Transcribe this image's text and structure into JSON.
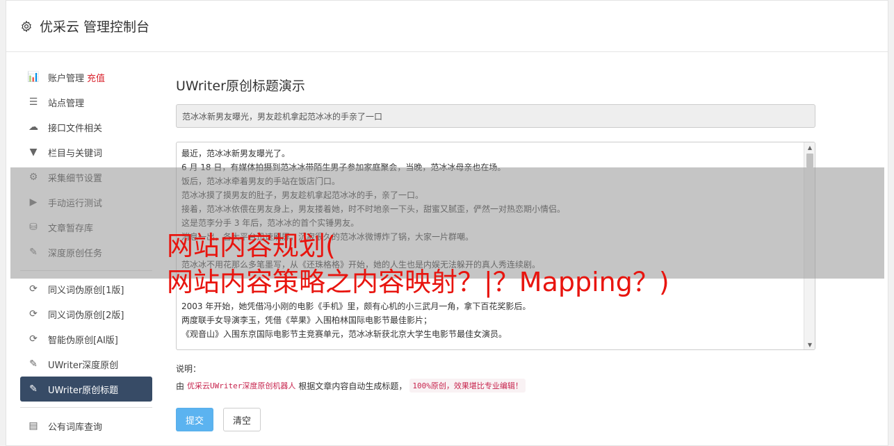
{
  "header": {
    "title": "优采云 管理控制台"
  },
  "sidebar": {
    "group1": [
      {
        "label": "账户管理",
        "badge": "充值",
        "icon": "bar-chart-icon",
        "glyph": "📊"
      },
      {
        "label": "站点管理",
        "icon": "server-icon",
        "glyph": "☰"
      },
      {
        "label": "接口文件相关",
        "icon": "cloud-upload-icon",
        "glyph": "☁"
      },
      {
        "label": "栏目与关键词",
        "icon": "filter-icon",
        "glyph": "▼"
      },
      {
        "label": "采集细节设置",
        "icon": "gears-icon",
        "glyph": "⚙"
      },
      {
        "label": "手动运行测试",
        "icon": "play-circle-icon",
        "glyph": "▶"
      },
      {
        "label": "文章暂存库",
        "icon": "database-icon",
        "glyph": "⛁"
      },
      {
        "label": "深度原创任务",
        "icon": "edit-icon",
        "glyph": "✎"
      }
    ],
    "group2": [
      {
        "label": "同义词伪原创[1版]",
        "icon": "refresh-icon",
        "glyph": "⟳"
      },
      {
        "label": "同义词伪原创[2版]",
        "icon": "refresh-icon",
        "glyph": "⟳"
      },
      {
        "label": "智能伪原创[AI版]",
        "icon": "refresh-icon",
        "glyph": "⟳"
      },
      {
        "label": "UWriter深度原创",
        "icon": "edit-icon",
        "glyph": "✎"
      },
      {
        "label": "UWriter原创标题",
        "icon": "edit-icon",
        "glyph": "✎",
        "active": true
      }
    ],
    "group3": [
      {
        "label": "公有词库查询",
        "icon": "book-icon",
        "glyph": "▤"
      }
    ]
  },
  "main": {
    "page_title": "UWriter原创标题演示",
    "title_value": "范冰冰新男友曝光，男友趁机拿起范冰冰的手亲了一口",
    "content_lines": [
      "最近，范冰冰新男友曝光了。",
      "6 月 18 日，有媒体拍摄到范冰冰带陌生男子参加家庭聚会，当晚，范冰冰母亲也在场。",
      "饭后，范冰冰牵着男友的手站在饭店门口。",
      "范冰冰摸了摸男友的肚子，男友趁机拿起范冰冰的手，亲了一口。",
      "接着，范冰冰依偎在男友身上，男友搂着她，时不时地亲一下头，甜蜜又腻歪，俨然一对热恋期小情侣。",
      "这是范李分手 3 年后，范冰冰的首个实锤男友。",
      "消息一出，各大平台迅速刷屏，沉寂很久的范冰冰微博炸了锅，大家一片群嘲。",
      "",
      "范冰冰不用花那么多笔墨写，从《还珠格格》开始，她的人生也是内娱无法躲开的真人秀连续剧。",
      "",
      "",
      "2003 年开始，她凭借冯小刚的电影《手机》里，颇有心机的小三武月一角，拿下百花奖影后。",
      "两度联手女导演李玉，凭借《苹果》入围柏林国际电影节最佳影片；",
      "《观音山》入围东京国际电影节主竞赛单元，范冰冰斩获北京大学生电影节最佳女演员。"
    ],
    "note_label": "说明：",
    "note_prefix": "由",
    "note_red": "优采云UWriter深度原创机器人",
    "note_middle": "根据文章内容自动生成标题，",
    "note_pill": "100%原创，效果堪比专业编辑！",
    "submit_label": "提交",
    "clear_label": "清空"
  },
  "overlay": {
    "line1": "网站内容规划(",
    "line2": "网站内容策略之内容映射？|？Mapping？)"
  }
}
